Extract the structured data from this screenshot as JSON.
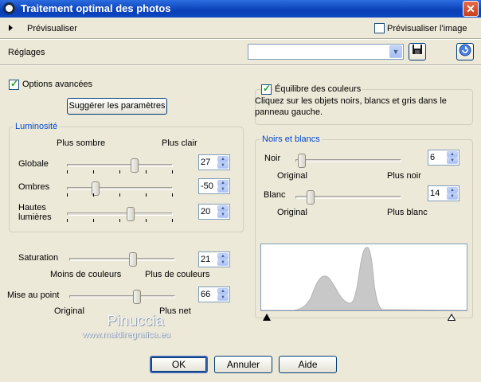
{
  "window": {
    "title": "Traitement optimal des photos",
    "close_glyph": "✕"
  },
  "preview": {
    "label": "Prévisualiser",
    "show_image_label": "Prévisualiser l'image",
    "show_image_checked": false
  },
  "settings": {
    "label": "Réglages",
    "preset_value": "",
    "save_icon": "floppy-disk-icon",
    "reset_icon": "reset-arrow-icon"
  },
  "advanced": {
    "label": "Options avancées",
    "checked": true,
    "suggest_button": "Suggérer les paramètres"
  },
  "luminosity": {
    "title": "Luminosité",
    "left_caption": "Plus sombre",
    "right_caption": "Plus clair",
    "rows": [
      {
        "label": "Globale",
        "value": "27",
        "level": 0.64
      },
      {
        "label": "Ombres",
        "value": "-50",
        "level": 0.27
      },
      {
        "label": "Hautes",
        "label2": "lumières",
        "value": "20",
        "level": 0.6
      }
    ]
  },
  "saturation": {
    "label": "Saturation",
    "value": "21",
    "level": 0.6,
    "left_caption": "Moins de couleurs",
    "right_caption": "Plus de couleurs"
  },
  "focus": {
    "label": "Mise au point",
    "value": "66",
    "level": 0.64,
    "left_caption": "Original",
    "right_caption": "Plus net"
  },
  "color_balance": {
    "label": "Équilibre des couleurs",
    "checked": true,
    "note": "Cliquez sur les objets noirs, blancs et gris dans le panneau gauche."
  },
  "black_white": {
    "title": "Noirs et blancs",
    "black": {
      "label": "Noir",
      "value": "6",
      "level": 0.06,
      "left_caption": "Original",
      "right_caption": "Plus noir"
    },
    "white": {
      "label": "Blanc",
      "value": "14",
      "level": 0.14,
      "left_caption": "Original",
      "right_caption": "Plus blanc"
    }
  },
  "watermark": {
    "name": "Pinuccia",
    "url": "www.maidiregrafica.eu"
  },
  "buttons": {
    "ok": "OK",
    "cancel": "Annuler",
    "help": "Aide"
  },
  "colors": {
    "title_bar": "#0a3fb6",
    "dialog_bg": "#ece9d8",
    "group_title": "#0046d5",
    "histogram_fill": "#c8c8c8"
  }
}
